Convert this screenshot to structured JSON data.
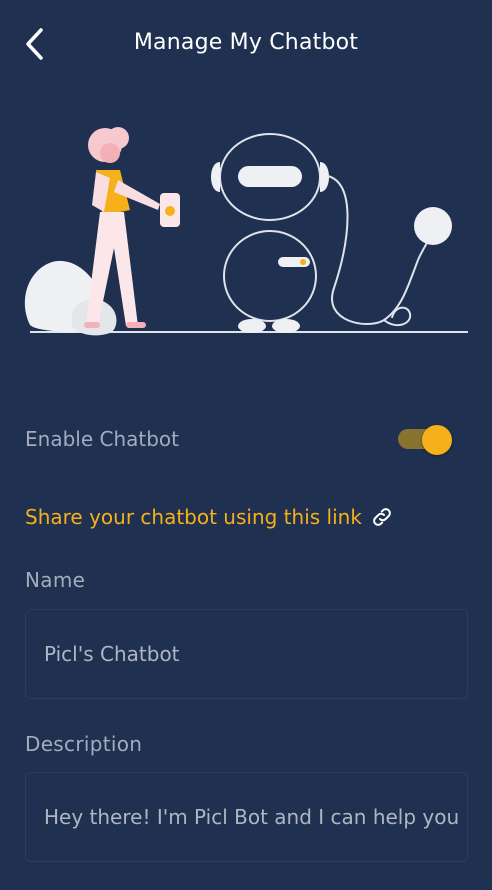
{
  "header": {
    "title": "Manage My Chatbot",
    "back_icon": "chevron-left-icon"
  },
  "illustration": {
    "name": "chatbot-illustration"
  },
  "settings": {
    "enable_label": "Enable Chatbot",
    "enabled": true,
    "share_link_text": "Share your chatbot using this link",
    "share_icon": "link-icon"
  },
  "form": {
    "name_label": "Name",
    "name_value": "Picl's Chatbot",
    "description_label": "Description",
    "description_value": "Hey there! I'm Picl Bot and I can help you"
  },
  "colors": {
    "background": "#1f3050",
    "accent": "#f5b01a",
    "muted_text": "#a3acbb"
  }
}
